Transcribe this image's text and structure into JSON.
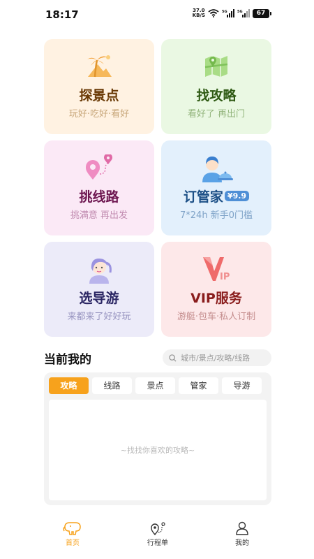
{
  "status_bar": {
    "time": "18:17",
    "net_speed_value": "37.0",
    "net_speed_unit": "KB/S",
    "battery": "67"
  },
  "cards": [
    {
      "title": "探景点",
      "subtitle": "玩好·吃好·看好",
      "icon": "palm-beach-icon"
    },
    {
      "title": "找攻略",
      "subtitle": "看好了 再出门",
      "icon": "map-icon"
    },
    {
      "title": "挑线路",
      "subtitle": "挑满意 再出发",
      "icon": "route-pin-icon"
    },
    {
      "title": "订管家",
      "subtitle": "7*24h 新手0门槛",
      "icon": "butler-icon",
      "badge": "¥9.9"
    },
    {
      "title": "选导游",
      "subtitle": "来都来了好好玩",
      "icon": "guide-girl-icon"
    },
    {
      "title": "VIP服务",
      "subtitle": "游艇·包车·私人订制",
      "icon": "vip-icon"
    }
  ],
  "section": {
    "title": "当前我的",
    "search_placeholder": "城市/景点/攻略/线路"
  },
  "tabs": [
    {
      "label": "攻略",
      "active": true
    },
    {
      "label": "线路",
      "active": false
    },
    {
      "label": "景点",
      "active": false
    },
    {
      "label": "管家",
      "active": false
    },
    {
      "label": "导游",
      "active": false
    }
  ],
  "empty_text": "~找找你喜欢的攻略~",
  "bottom_nav": [
    {
      "label": "首页",
      "icon": "elephant-home-icon",
      "active": true
    },
    {
      "label": "行程单",
      "icon": "itinerary-pin-icon",
      "active": false
    },
    {
      "label": "我的",
      "icon": "profile-icon",
      "active": false
    }
  ],
  "colors": {
    "accent": "#f7a21c"
  }
}
